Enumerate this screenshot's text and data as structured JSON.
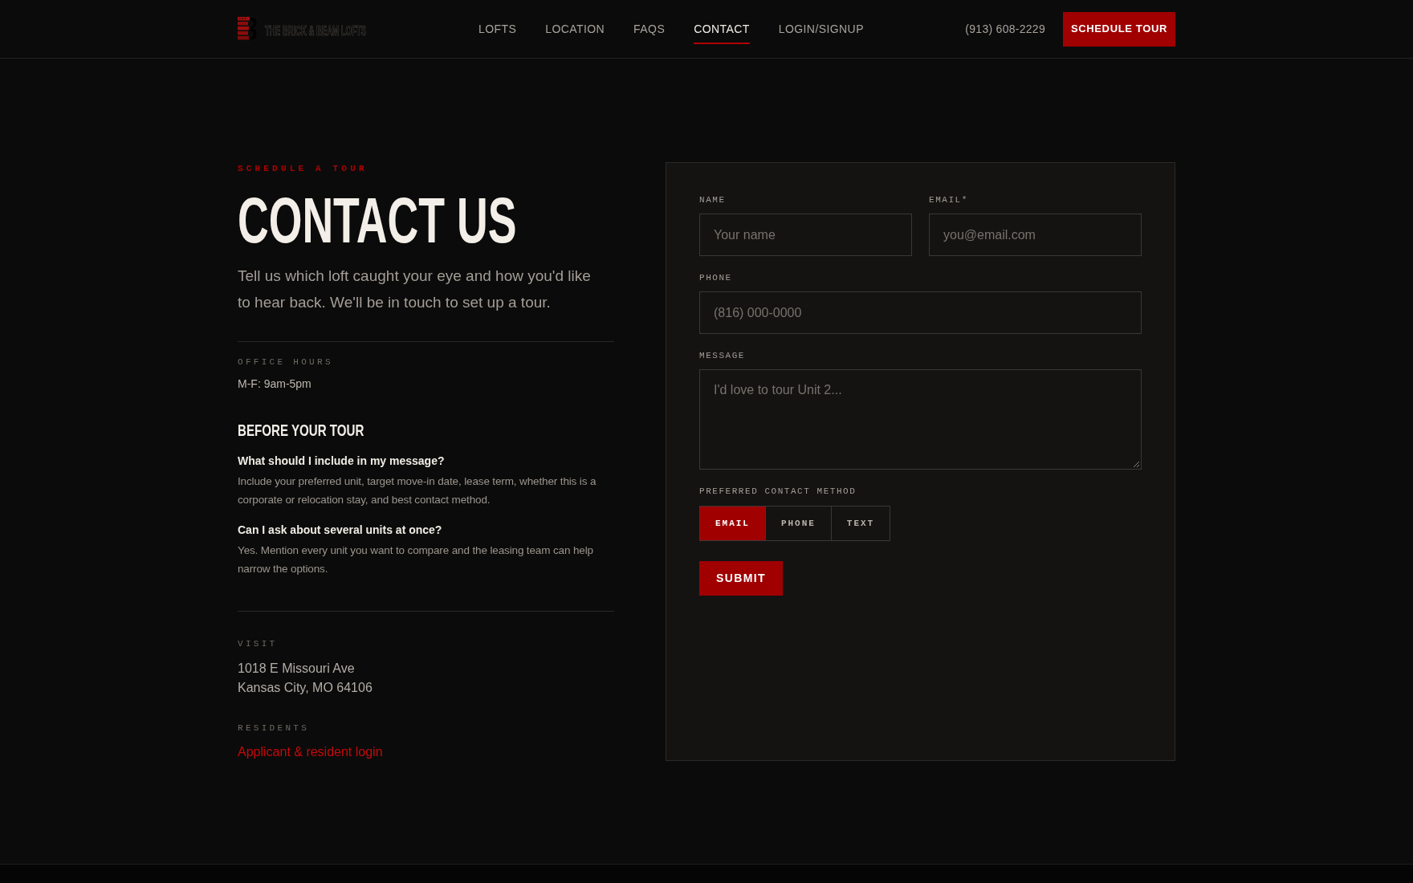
{
  "header": {
    "logo": {
      "text": "THE BRICK & BEAM LOFTS"
    },
    "nav": [
      {
        "label": "LOFTS",
        "selected": false
      },
      {
        "label": "LOCATION",
        "selected": false
      },
      {
        "label": "FAQS",
        "selected": false
      },
      {
        "label": "CONTACT",
        "selected": true
      },
      {
        "label": "LOGIN/SIGNUP",
        "selected": false
      }
    ],
    "phone": "(913) 608-2229",
    "cta": "SCHEDULE TOUR"
  },
  "intro": {
    "eyebrow": "SCHEDULE A TOUR",
    "title": "CONTACT US",
    "lead": "Tell us which loft caught your eye and how you'd like to hear back. We'll be in touch to set up a tour."
  },
  "office_hours": {
    "label": "OFFICE HOURS",
    "value": "M-F: 9am-5pm"
  },
  "faq": {
    "title": "BEFORE YOUR TOUR",
    "items": [
      {
        "question": "What should I include in my message?",
        "answer": "Include your preferred unit, target move-in date, lease term, whether this is a corporate or relocation stay, and best contact method."
      },
      {
        "question": "Can I ask about several units at once?",
        "answer": "Yes. Mention every unit you want to compare and the leasing team can help narrow the options."
      }
    ]
  },
  "visit": {
    "label": "VISIT",
    "address": [
      "1018 E Missouri Ave",
      "Kansas City, MO 64106"
    ]
  },
  "residents": {
    "label": "RESIDENTS",
    "link": "Applicant & resident login"
  },
  "form": {
    "rows": [
      [
        {
          "kind": "input",
          "label": "NAME",
          "placeholder": "Your name"
        },
        {
          "kind": "input",
          "label": "EMAIL*",
          "placeholder": "you@email.com"
        }
      ],
      [
        {
          "kind": "input",
          "label": "PHONE",
          "placeholder": "(816) 000-0000"
        }
      ],
      [
        {
          "kind": "textarea",
          "label": "MESSAGE",
          "placeholder": "I'd love to tour Unit 2..."
        }
      ]
    ],
    "contact_method": {
      "label": "PREFERRED CONTACT METHOD",
      "options": [
        {
          "label": "EMAIL",
          "selected": true
        },
        {
          "label": "PHONE",
          "selected": false
        },
        {
          "label": "TEXT",
          "selected": false
        }
      ]
    },
    "submit": "SUBMIT"
  }
}
